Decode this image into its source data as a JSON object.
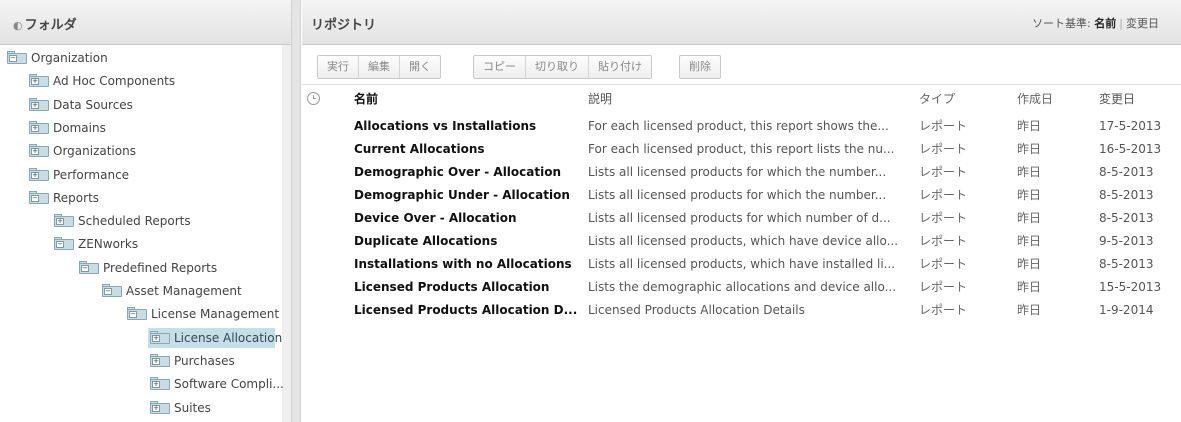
{
  "folders_panel": {
    "title": "フォルダ",
    "tree": [
      {
        "label": "Organization",
        "depth": 0,
        "expanded": true
      },
      {
        "label": "Ad Hoc Components",
        "depth": 1,
        "expanded": false
      },
      {
        "label": "Data Sources",
        "depth": 1,
        "expanded": false
      },
      {
        "label": "Domains",
        "depth": 1,
        "expanded": false
      },
      {
        "label": "Organizations",
        "depth": 1,
        "expanded": false
      },
      {
        "label": "Performance",
        "depth": 1,
        "expanded": false
      },
      {
        "label": "Reports",
        "depth": 1,
        "expanded": true
      },
      {
        "label": "Scheduled Reports",
        "depth": 2,
        "expanded": false
      },
      {
        "label": "ZENworks",
        "depth": 2,
        "expanded": true
      },
      {
        "label": "Predefined Reports",
        "depth": 3,
        "expanded": true
      },
      {
        "label": "Asset Management",
        "depth": 4,
        "expanded": true
      },
      {
        "label": "License Management",
        "depth": 5,
        "expanded": true
      },
      {
        "label": "License Allocation",
        "depth": 6,
        "expanded": false,
        "selected": true
      },
      {
        "label": "Purchases",
        "depth": 6,
        "expanded": false
      },
      {
        "label": "Software Compli...",
        "depth": 6,
        "expanded": false
      },
      {
        "label": "Suites",
        "depth": 6,
        "expanded": false
      }
    ]
  },
  "repository": {
    "title": "リポジトリ",
    "sort": {
      "label": "ソート基準:",
      "active": "名前",
      "other": "変更日"
    },
    "toolbar": {
      "groups": [
        [
          "実行",
          "編集",
          "開く"
        ],
        [
          "コピー",
          "切り取り",
          "貼り付け"
        ],
        [
          "削除"
        ]
      ]
    },
    "columns": {
      "name": "名前",
      "description": "説明",
      "type": "タイプ",
      "created": "作成日",
      "modified": "変更日"
    },
    "rows": [
      {
        "name": "Allocations vs Installations",
        "description": "For each licensed product, this report shows the...",
        "type": "レポート",
        "created": "昨日",
        "modified": "17-5-2013"
      },
      {
        "name": "Current Allocations",
        "description": "For each licensed product, this report lists the nu...",
        "type": "レポート",
        "created": "昨日",
        "modified": "16-5-2013"
      },
      {
        "name": "Demographic Over - Allocation",
        "description": "Lists all licensed products for which the number...",
        "type": "レポート",
        "created": "昨日",
        "modified": "8-5-2013"
      },
      {
        "name": "Demographic Under - Allocation",
        "description": "Lists all licensed products for which the number...",
        "type": "レポート",
        "created": "昨日",
        "modified": "8-5-2013"
      },
      {
        "name": "Device Over - Allocation",
        "description": "Lists all licensed products for which number of d...",
        "type": "レポート",
        "created": "昨日",
        "modified": "8-5-2013"
      },
      {
        "name": "Duplicate Allocations",
        "description": "Lists all licensed products, which have device allo...",
        "type": "レポート",
        "created": "昨日",
        "modified": "9-5-2013"
      },
      {
        "name": "Installations with no Allocations",
        "description": "Lists all licensed products, which have installed li...",
        "type": "レポート",
        "created": "昨日",
        "modified": "8-5-2013"
      },
      {
        "name": "Licensed Products Allocation",
        "description": "Lists the demographic allocations and device allo...",
        "type": "レポート",
        "created": "昨日",
        "modified": "15-5-2013"
      },
      {
        "name": "Licensed Products Allocation D...",
        "description": "Licensed Products Allocation Details",
        "type": "レポート",
        "created": "昨日",
        "modified": "1-9-2014"
      }
    ]
  }
}
